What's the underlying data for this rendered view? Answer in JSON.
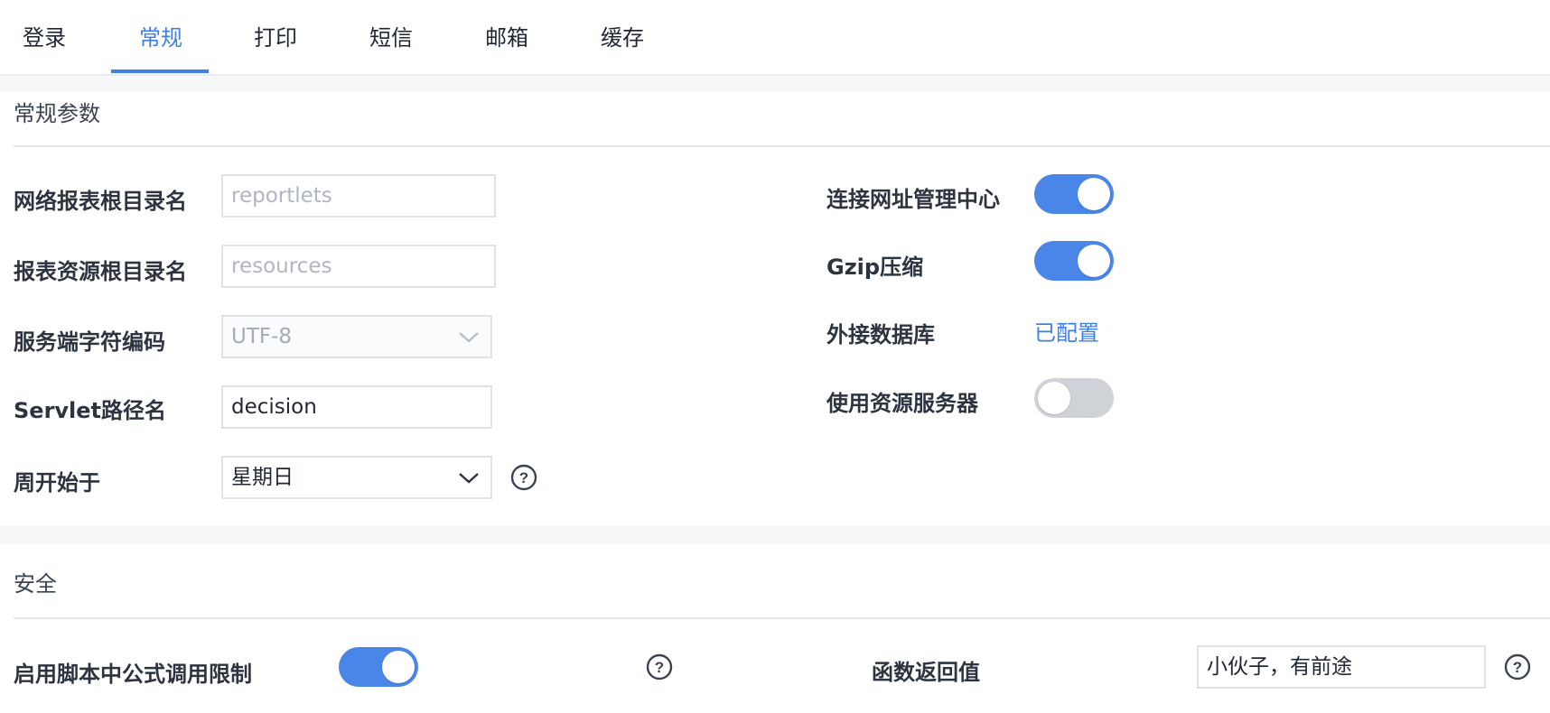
{
  "tabs": [
    {
      "label": "登录"
    },
    {
      "label": "常规"
    },
    {
      "label": "打印"
    },
    {
      "label": "短信"
    },
    {
      "label": "邮箱"
    },
    {
      "label": "缓存"
    }
  ],
  "active_tab": "常规",
  "general": {
    "title": "常规参数",
    "web_root_label": "网络报表根目录名",
    "web_root_placeholder": "reportlets",
    "resource_root_label": "报表资源根目录名",
    "resource_root_placeholder": "resources",
    "encoding_label": "服务端字符编码",
    "encoding_value": "UTF-8",
    "servlet_label": "Servlet路径名",
    "servlet_value": "decision",
    "week_start_label": "周开始于",
    "week_start_value": "星期日",
    "connect_center_label": "连接网址管理中心",
    "connect_center_on": true,
    "gzip_label": "Gzip压缩",
    "gzip_on": true,
    "external_db_label": "外接数据库",
    "external_db_link": "已配置",
    "resource_server_label": "使用资源服务器",
    "resource_server_on": false
  },
  "security": {
    "title": "安全",
    "formula_limit_label": "启用脚本中公式调用限制",
    "formula_limit_on": true,
    "return_value_label": "函数返回值",
    "return_value": "小伙子，有前途"
  },
  "colors": {
    "accent": "#3f7fe6",
    "toggle_on": "#4a86e8",
    "toggle_off": "#cfd3d8",
    "band": "#f5f7f9"
  },
  "icons": {
    "help": "question-circle-icon",
    "dropdown": "chevron-down-icon"
  }
}
